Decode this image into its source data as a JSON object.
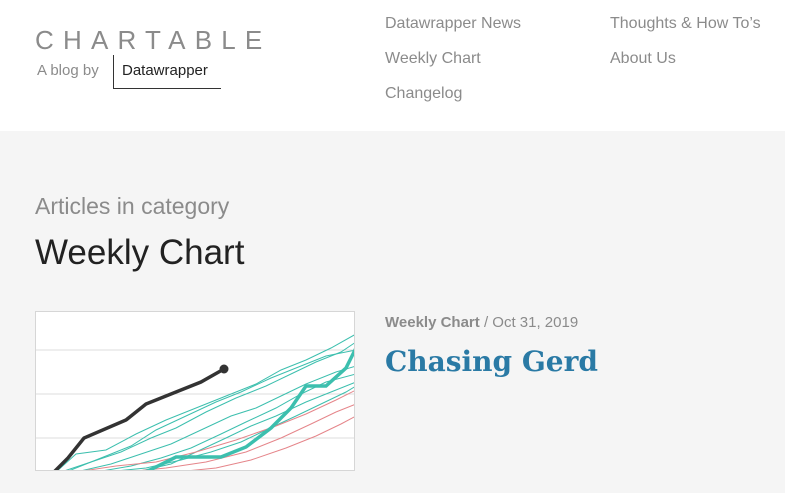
{
  "header": {
    "logo": "CHARTABLE",
    "byline": "A blog by",
    "brand": "Datawrapper",
    "nav": [
      "Datawrapper News",
      "Weekly Chart",
      "Changelog",
      "Thoughts & How To’s",
      "About Us"
    ]
  },
  "category": {
    "prefix": "Articles in category",
    "title": "Weekly Chart"
  },
  "post": {
    "category": "Weekly Chart",
    "separator": "/",
    "date": "Oct 31, 2019",
    "title": "Chasing Gerd"
  },
  "colors": {
    "accent": "#2a7aa5",
    "teal": "#3cbfae",
    "red": "#e5858a",
    "dark": "#333333"
  }
}
